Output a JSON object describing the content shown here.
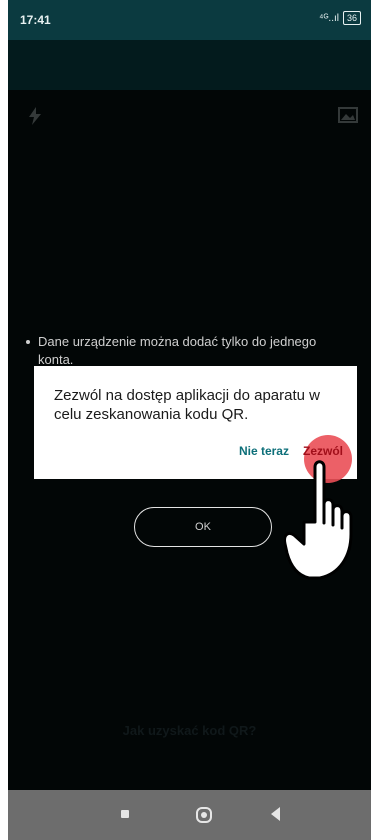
{
  "status_bar": {
    "time": "17:41",
    "signal": "⁴ᴳ..ıl",
    "battery": "36"
  },
  "note": {
    "text": "Dane urządzenie można dodać tylko do jednego konta."
  },
  "dialog": {
    "message": "Zezwól na dostęp aplikacji do aparatu w celu zeskanowania kodu QR.",
    "secondary_label": "Nie teraz",
    "primary_label": "Zezwól"
  },
  "ok_button": {
    "label": "OK"
  },
  "qr_help": {
    "text": "Jak uzyskać kod QR?"
  },
  "colors": {
    "status_bar": "#0b3a40",
    "accent": "#0d6f79",
    "tap_highlight": "#ea4f56"
  },
  "icons": [
    "flash-icon",
    "gallery-icon",
    "tap-hand-icon",
    "recents-icon",
    "home-icon",
    "back-icon"
  ]
}
